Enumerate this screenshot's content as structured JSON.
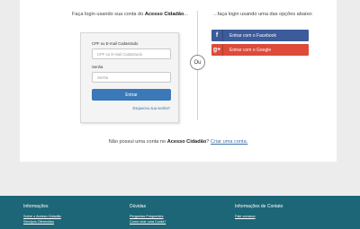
{
  "login": {
    "left_title_prefix": "Faça login usando sua conta do ",
    "left_title_bold": "Acesso Cidadão",
    "left_title_suffix": "...",
    "cpf_label": "CPF ou E-mail Cadastrado",
    "cpf_placeholder": "CPF ou E-mail Cadastrado",
    "senha_label": "Senha",
    "senha_placeholder": "Senha",
    "submit_label": "Entrar",
    "forgot_label": "Esqueceu sua senha?"
  },
  "separator": {
    "ou_label": "Ou"
  },
  "social": {
    "title": "...faça login usando uma das opções abaixo:",
    "facebook": {
      "icon": "f",
      "label": "Entrar com o Facebook",
      "color": "#3b5b99"
    },
    "google": {
      "icon": "g+",
      "label": "Entrar com o Google",
      "color": "#dd4b39"
    }
  },
  "signup": {
    "prefix": "Não possui uma conta no ",
    "bold": "Acesso Cidadão",
    "suffix": "? ",
    "link": "Criar uma conta."
  },
  "footer": {
    "background": "#1c6677",
    "columns": [
      {
        "title": "Informações",
        "links": [
          "Sobre o Acesso Cidadão",
          "Serviços Oferecidos"
        ]
      },
      {
        "title": "Dúvidas",
        "links": [
          "Perguntas Frequentes",
          "Como criar uma Conta?"
        ]
      },
      {
        "title": "Informações de Contato",
        "links": [
          "Fale conosco"
        ]
      }
    ]
  }
}
